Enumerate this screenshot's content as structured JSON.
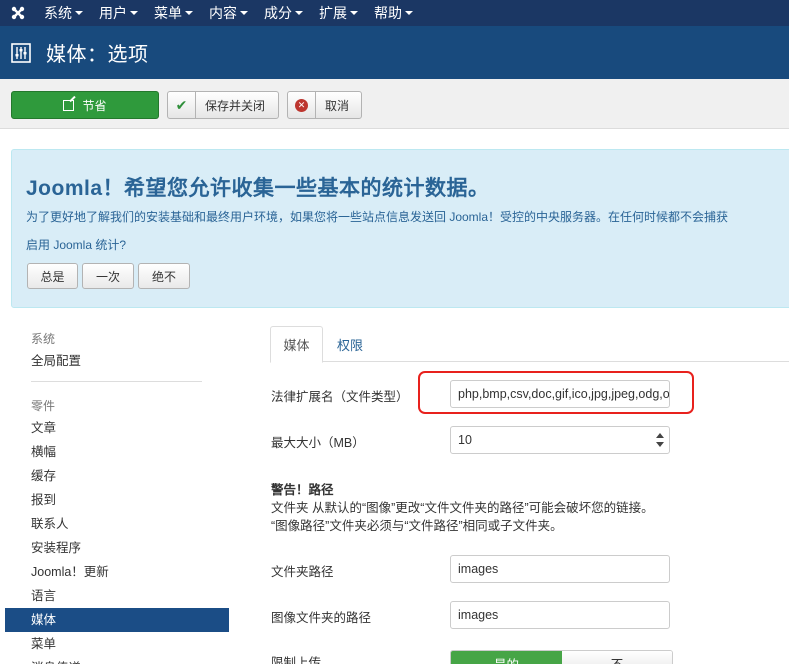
{
  "topbar": {
    "logo_icon": "joomla-logo-icon",
    "menu": [
      {
        "label": "系统"
      },
      {
        "label": "用户"
      },
      {
        "label": "菜单"
      },
      {
        "label": "内容"
      },
      {
        "label": "成分"
      },
      {
        "label": "扩展"
      },
      {
        "label": "帮助"
      }
    ]
  },
  "header": {
    "title": "媒体：选项",
    "icon": "options-sliders-icon"
  },
  "toolbar": {
    "save_label": "节省",
    "save_close_label": "保存并关闭",
    "cancel_label": "取消"
  },
  "alert": {
    "heading": "Joomla！希望您允许收集一些基本的统计数据。",
    "description": "为了更好地了解我们的安装基础和最终用户环境，如果您将一些站点信息发送回 Joomla！受控的中央服务器。在任何时候都不会捕获",
    "question": "启用 Joomla 统计?",
    "always_label": "总是",
    "once_label": "一次",
    "never_label": "绝不"
  },
  "sidebar": {
    "section_system": "系统",
    "global_config": "全局配置",
    "section_components": "零件",
    "items": [
      {
        "label": "文章"
      },
      {
        "label": "横幅"
      },
      {
        "label": "缓存"
      },
      {
        "label": "报到"
      },
      {
        "label": "联系人"
      },
      {
        "label": "安装程序"
      },
      {
        "label": "Joomla！更新"
      },
      {
        "label": "语言"
      },
      {
        "label": "媒体"
      },
      {
        "label": "菜单"
      },
      {
        "label": "消息传递"
      }
    ],
    "active_index": 8
  },
  "tabs": {
    "media_label": "媒体",
    "permissions_label": "权限"
  },
  "form": {
    "extensions_label": "法律扩展名（文件类型）",
    "extensions_value": "php,bmp,csv,doc,gif,ico,jpg,jpeg,odg,odp,ods,odt,pdf,png,ppt,txt,xcf,xls",
    "max_size_label": "最大大小（MB）",
    "max_size_value": "10",
    "warning_title": "警告！路径",
    "warning_line1": "文件夹 从默认的“图像”更改“文件文件夹的路径”可能会破坏您的链接。",
    "warning_line2": "“图像路径”文件夹必须与“文件路径”相同或子文件夹。",
    "file_path_label": "文件夹路径",
    "file_path_value": "images",
    "image_path_label": "图像文件夹的路径",
    "image_path_value": "images",
    "restrict_label": "限制上传",
    "yes_label": "是的",
    "no_label": "不"
  },
  "colors": {
    "topbar": "#1b3764",
    "titlebar": "#184a7d",
    "save_button": "#2f9a3c",
    "active_sidebar": "#1b4d86",
    "highlight": "#e8211d",
    "toggle_yes": "#46a546"
  }
}
